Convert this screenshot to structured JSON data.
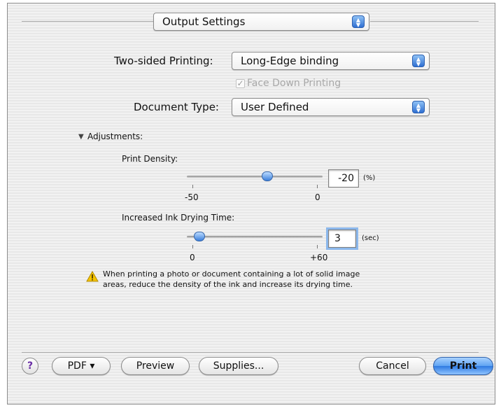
{
  "panel_menu": {
    "value": "Output Settings"
  },
  "duplex": {
    "label": "Two-sided Printing:",
    "value": "Long-Edge binding"
  },
  "face_down": {
    "label": "Face Down Printing",
    "checked": true,
    "enabled": false
  },
  "document_type": {
    "label": "Document Type:",
    "value": "User Defined"
  },
  "adjustments": {
    "disclosure_icon": "triangle-down",
    "label": "Adjustments:"
  },
  "print_density": {
    "label": "Print Density:",
    "min_label": "-50",
    "zero_label": "0",
    "value": "-20",
    "unit": "(%)",
    "slider_value": -20,
    "slider_min": -50,
    "slider_max": 0
  },
  "drying_time": {
    "label": "Increased Ink Drying Time:",
    "min_label": "0",
    "max_label": "+60",
    "value": "3",
    "unit": "(sec)",
    "slider_value": 3,
    "slider_min": 0,
    "slider_max": 60
  },
  "warning": {
    "icon": "warning-triangle",
    "text_line1": "When printing a photo or document containing a lot of solid image",
    "text_line2": "areas, reduce the density of the ink and increase its drying time."
  },
  "buttons": {
    "help": "?",
    "pdf": "PDF ▾",
    "preview": "Preview",
    "supplies": "Supplies...",
    "cancel": "Cancel",
    "print": "Print"
  },
  "colors": {
    "accent": "#3b7fdb",
    "warning": "#f2c200"
  }
}
